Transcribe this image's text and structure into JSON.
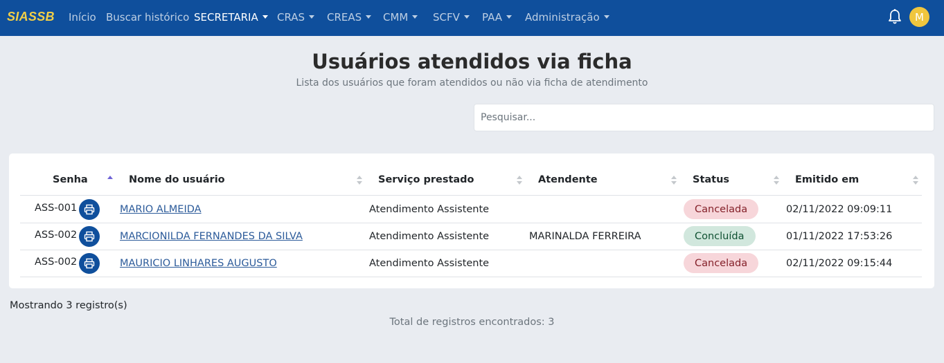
{
  "navbar": {
    "brand": "SIASSB",
    "items": [
      {
        "label": "Início",
        "dropdown": false
      },
      {
        "label": "Buscar histórico",
        "dropdown": false
      },
      {
        "label": "SECRETARIA",
        "dropdown": true,
        "active": true
      },
      {
        "label": "CRAS",
        "dropdown": true
      },
      {
        "label": "CREAS",
        "dropdown": true
      },
      {
        "label": "CMM",
        "dropdown": true
      },
      {
        "label": "SCFV",
        "dropdown": true
      },
      {
        "label": "PAA",
        "dropdown": true
      },
      {
        "label": "Administração",
        "dropdown": true
      }
    ],
    "notifications_icon": "bell-icon",
    "avatar_initial": "M",
    "colors": {
      "background": "#0f4f9c",
      "brand": "#f2cf47",
      "avatar": "#f0c63e"
    }
  },
  "header": {
    "title": "Usuários atendidos via ficha",
    "subtitle": "Lista dos usuários que foram atendidos ou não via ficha de atendimento"
  },
  "search": {
    "placeholder": "Pesquisar...",
    "value": ""
  },
  "table": {
    "columns": [
      {
        "label": "Senha",
        "sort": "asc"
      },
      {
        "label": "Nome do usuário",
        "sort": "none"
      },
      {
        "label": "Serviço prestado",
        "sort": "none"
      },
      {
        "label": "Atendente",
        "sort": "none"
      },
      {
        "label": "Status",
        "sort": "none"
      },
      {
        "label": "Emitido em",
        "sort": "none"
      }
    ],
    "rows": [
      {
        "senha": "ASS-001",
        "nome": "MARIO ALMEIDA",
        "servico": "Atendimento Assistente",
        "atendente": "",
        "status": "Cancelada",
        "emitido": "02/11/2022 09:09:11"
      },
      {
        "senha": "ASS-002",
        "nome": "MARCIONILDA FERNANDES DA SILVA",
        "servico": "Atendimento Assistente",
        "atendente": "MARINALDA FERREIRA",
        "status": "Concluída",
        "emitido": "01/11/2022 17:53:26"
      },
      {
        "senha": "ASS-002",
        "nome": "MAURICIO LINHARES AUGUSTO",
        "servico": "Atendimento Assistente",
        "atendente": "",
        "status": "Cancelada",
        "emitido": "02/11/2022 09:15:44"
      }
    ],
    "row_action_icon": "printer-icon",
    "status_colors": {
      "Cancelada": "#f7d6da",
      "Concluída": "#d1e7dd"
    }
  },
  "footer": {
    "showing": "Mostrando 3 registro(s)",
    "total": "Total de registros encontrados: 3"
  }
}
